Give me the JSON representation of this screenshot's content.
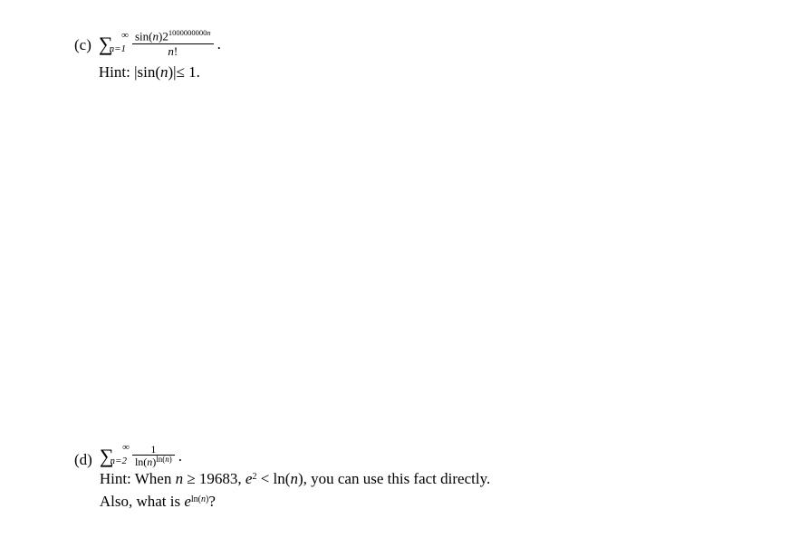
{
  "problems": {
    "c": {
      "label": "(c)",
      "sigma_lower": "n=1",
      "sigma_upper": "∞",
      "frac_num_prefix": "sin(",
      "frac_num_var": "n",
      "frac_num_mid": ")2",
      "frac_num_exp": "1000000000",
      "frac_num_exp_var": "n",
      "frac_den_var": "n",
      "frac_den_bang": "!",
      "period": ".",
      "hint_label": "Hint:",
      "hint_space": " ",
      "hint_bar1": "|",
      "hint_sin": " sin(",
      "hint_var": "n",
      "hint_close": ")",
      "hint_bar2": "|",
      "hint_rel": " ≤ 1."
    },
    "d": {
      "label": "(d)",
      "sigma_lower": "n=2",
      "sigma_upper": "∞",
      "frac_num": "1",
      "frac_den_ln": "ln(",
      "frac_den_var": "n",
      "frac_den_close": ")",
      "frac_den_exp_ln": "ln(",
      "frac_den_exp_var": "n",
      "frac_den_exp_close": ")",
      "period": ".",
      "hint_label": "Hint:",
      "hint_text1": "  When ",
      "hint_n": "n",
      "hint_rel": " ≥ 19683, ",
      "hint_e": "e",
      "hint_e_sup": "2",
      "hint_lt": " < ln(",
      "hint_n2": "n",
      "hint_text2": "), you can use this fact directly.",
      "hint_line2a": "Also, what is ",
      "hint_e2": "e",
      "hint_e2_sup_ln": "ln(",
      "hint_e2_sup_var": "n",
      "hint_e2_sup_close": ")",
      "hint_line2b": "?"
    }
  }
}
